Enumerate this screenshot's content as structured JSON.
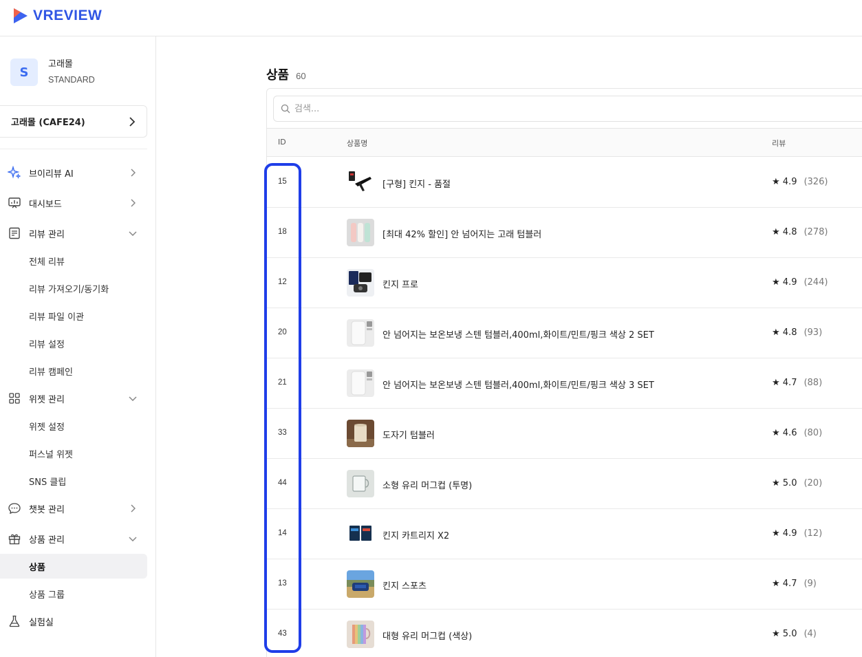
{
  "brand": {
    "name": "VREVIEW"
  },
  "account": {
    "initial": "S",
    "name": "고래몰",
    "plan": "STANDARD"
  },
  "store": {
    "label": "고래몰 (CAFE24)"
  },
  "nav": {
    "ai": "브이리뷰 AI",
    "dashboard": "대시보드",
    "review_mgmt": "리뷰 관리",
    "review_all": "전체 리뷰",
    "review_import": "리뷰 가져오기/동기화",
    "review_file": "리뷰 파일 이관",
    "review_settings": "리뷰 설정",
    "review_campaign": "리뷰 캠페인",
    "widget_mgmt": "위젯 관리",
    "widget_settings": "위젯 설정",
    "personal_widget": "퍼스널 위젯",
    "sns_clip": "SNS 클립",
    "chatbot_mgmt": "챗봇 관리",
    "product_mgmt": "상품 관리",
    "products": "상품",
    "product_group": "상품 그룹",
    "lab": "실험실"
  },
  "page": {
    "title": "상품",
    "count": "60"
  },
  "search": {
    "placeholder": "검색..."
  },
  "table": {
    "headers": {
      "id": "ID",
      "name": "상품명",
      "review": "리뷰"
    },
    "rows": [
      {
        "id": "15",
        "name": "[구형] 킨지 - 품절",
        "rating": "★ 4.9",
        "count": "(326)"
      },
      {
        "id": "18",
        "name": "[최대 42% 할인] 안 넘어지는 고래 텀블러",
        "rating": "★ 4.8",
        "count": "(278)"
      },
      {
        "id": "12",
        "name": "킨지 프로",
        "rating": "★ 4.9",
        "count": "(244)"
      },
      {
        "id": "20",
        "name": "안 넘어지는 보온보냉 스텐 텀블러,400ml,화이트/민트/핑크 색상 2 SET",
        "rating": "★ 4.8",
        "count": "(93)"
      },
      {
        "id": "21",
        "name": "안 넘어지는 보온보냉 스텐 텀블러,400ml,화이트/민트/핑크 색상 3 SET",
        "rating": "★ 4.7",
        "count": "(88)"
      },
      {
        "id": "33",
        "name": "도자기 텀블러",
        "rating": "★ 4.6",
        "count": "(80)"
      },
      {
        "id": "44",
        "name": "소형 유리 머그컵 (투명)",
        "rating": "★ 5.0",
        "count": "(20)"
      },
      {
        "id": "14",
        "name": "킨지 카트리지 X2",
        "rating": "★ 4.9",
        "count": "(12)"
      },
      {
        "id": "13",
        "name": "킨지 스포츠",
        "rating": "★ 4.7",
        "count": "(9)"
      },
      {
        "id": "43",
        "name": "대형 유리 머그컵 (색상)",
        "rating": "★ 5.0",
        "count": "(4)"
      }
    ]
  },
  "colors": {
    "accent": "#2f55e4",
    "highlight": "#1f3ee8"
  },
  "icons": [
    "sparkle-icon",
    "dashboard-icon",
    "review-icon",
    "widget-icon",
    "chat-icon",
    "gift-icon",
    "flask-icon",
    "search-icon",
    "chevron-right-icon",
    "chevron-down-icon"
  ]
}
